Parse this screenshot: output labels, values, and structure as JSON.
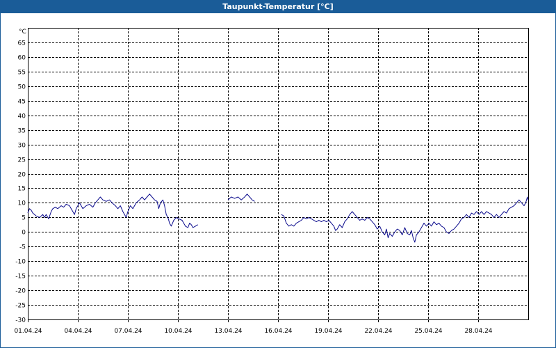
{
  "window": {
    "title": "Taupunkt-Temperatur [°C]"
  },
  "chart_data": {
    "type": "line",
    "title": "Taupunkt-Temperatur [°C]",
    "y_unit_label": "°C",
    "xlabel": "",
    "ylabel": "",
    "ylim": [
      -30,
      70
    ],
    "y_ticks": [
      65,
      60,
      55,
      50,
      45,
      40,
      35,
      30,
      25,
      20,
      15,
      10,
      5,
      0,
      -5,
      -10,
      -15,
      -20,
      -25,
      -30
    ],
    "x_tick_labels": [
      "01.04.24",
      "04.04.24",
      "07.04.24",
      "10.04.24",
      "13.04.24",
      "16.04.24",
      "19.04.24",
      "22.04.24",
      "25.04.24",
      "28.04.24"
    ],
    "x_range_days": [
      0,
      30
    ],
    "grid": true,
    "legend": "none",
    "colors": {
      "line": "#0a0a8c",
      "grid": "#000000",
      "title_bg": "#1a5c98"
    },
    "series": [
      {
        "segments": [
          [
            [
              0.0,
              6.5
            ],
            [
              0.1,
              8
            ],
            [
              0.2,
              7.5
            ],
            [
              0.3,
              6.5
            ],
            [
              0.5,
              5.5
            ],
            [
              0.7,
              5
            ],
            [
              0.9,
              6
            ],
            [
              1.0,
              5
            ],
            [
              1.1,
              6
            ],
            [
              1.25,
              4.5
            ],
            [
              1.4,
              7
            ],
            [
              1.5,
              8
            ],
            [
              1.65,
              8.5
            ],
            [
              1.8,
              8
            ],
            [
              2.0,
              9
            ],
            [
              2.15,
              8.5
            ],
            [
              2.3,
              9.5
            ],
            [
              2.5,
              9
            ],
            [
              2.7,
              7
            ],
            [
              2.8,
              6
            ],
            [
              2.9,
              8
            ],
            [
              3.1,
              10
            ],
            [
              3.3,
              8
            ],
            [
              3.5,
              9
            ],
            [
              3.7,
              9.5
            ],
            [
              3.9,
              8.5
            ],
            [
              4.05,
              10
            ],
            [
              4.2,
              11
            ],
            [
              4.35,
              12
            ],
            [
              4.5,
              11
            ],
            [
              4.7,
              10.5
            ],
            [
              4.9,
              11
            ],
            [
              5.05,
              10
            ],
            [
              5.25,
              9
            ],
            [
              5.4,
              8
            ],
            [
              5.55,
              9
            ],
            [
              5.7,
              7
            ],
            [
              5.8,
              6
            ],
            [
              5.9,
              5
            ],
            [
              6.0,
              7
            ],
            [
              6.15,
              9
            ],
            [
              6.3,
              8
            ],
            [
              6.5,
              10
            ],
            [
              6.7,
              11
            ],
            [
              6.85,
              12
            ],
            [
              7.0,
              11
            ],
            [
              7.15,
              12
            ],
            [
              7.3,
              13
            ],
            [
              7.45,
              12
            ],
            [
              7.6,
              11
            ],
            [
              7.75,
              10.5
            ],
            [
              7.85,
              8
            ],
            [
              7.95,
              10
            ],
            [
              8.1,
              11
            ],
            [
              8.2,
              9
            ],
            [
              8.3,
              6
            ],
            [
              8.4,
              5
            ],
            [
              8.5,
              3
            ],
            [
              8.6,
              2
            ],
            [
              8.75,
              4
            ],
            [
              8.9,
              5
            ],
            [
              9.05,
              4.5
            ],
            [
              9.25,
              4
            ],
            [
              9.35,
              3
            ],
            [
              9.45,
              2
            ],
            [
              9.6,
              1.5
            ],
            [
              9.7,
              3
            ],
            [
              9.8,
              2.5
            ],
            [
              9.9,
              1.5
            ],
            [
              10.05,
              2
            ],
            [
              10.2,
              2.5
            ]
          ],
          [
            [
              12.0,
              11
            ],
            [
              12.2,
              12
            ],
            [
              12.4,
              11.5
            ],
            [
              12.6,
              12
            ],
            [
              12.8,
              11
            ],
            [
              13.0,
              12
            ],
            [
              13.15,
              13
            ],
            [
              13.3,
              12
            ],
            [
              13.45,
              11
            ],
            [
              13.6,
              10.5
            ]
          ],
          [
            [
              15.2,
              6
            ],
            [
              15.35,
              5.5
            ],
            [
              15.5,
              3
            ],
            [
              15.65,
              2
            ],
            [
              15.8,
              2.5
            ],
            [
              15.95,
              2
            ],
            [
              16.1,
              3
            ],
            [
              16.25,
              3.5
            ],
            [
              16.4,
              4
            ],
            [
              16.55,
              5
            ],
            [
              16.7,
              4.5
            ],
            [
              16.85,
              5
            ],
            [
              17.0,
              4.5
            ],
            [
              17.15,
              4
            ],
            [
              17.3,
              3.5
            ],
            [
              17.45,
              4
            ],
            [
              17.6,
              3.5
            ],
            [
              17.75,
              4
            ],
            [
              17.9,
              3.5
            ],
            [
              18.05,
              4
            ],
            [
              18.2,
              3
            ],
            [
              18.35,
              2
            ],
            [
              18.45,
              0.5
            ],
            [
              18.55,
              1
            ],
            [
              18.7,
              2.5
            ],
            [
              18.85,
              1.5
            ],
            [
              19.0,
              3.5
            ],
            [
              19.15,
              4.5
            ],
            [
              19.3,
              6
            ],
            [
              19.45,
              7
            ],
            [
              19.6,
              6
            ],
            [
              19.75,
              5
            ],
            [
              19.9,
              4
            ],
            [
              20.05,
              4.5
            ],
            [
              20.2,
              4
            ],
            [
              20.35,
              5
            ],
            [
              20.5,
              4.5
            ],
            [
              20.65,
              3.5
            ],
            [
              20.8,
              2.5
            ],
            [
              20.95,
              1
            ],
            [
              21.1,
              2
            ],
            [
              21.25,
              0
            ],
            [
              21.4,
              -1
            ],
            [
              21.5,
              1
            ],
            [
              21.6,
              -2
            ],
            [
              21.7,
              -0.5
            ],
            [
              21.85,
              -1.5
            ],
            [
              22.0,
              0
            ],
            [
              22.15,
              1
            ],
            [
              22.3,
              0.5
            ],
            [
              22.45,
              -1
            ],
            [
              22.6,
              1.5
            ],
            [
              22.75,
              -0.5
            ],
            [
              22.9,
              -1
            ],
            [
              23.0,
              0.5
            ],
            [
              23.1,
              -2
            ],
            [
              23.2,
              -3.5
            ],
            [
              23.3,
              -1
            ],
            [
              23.45,
              0
            ],
            [
              23.6,
              1.5
            ],
            [
              23.75,
              3
            ],
            [
              23.9,
              2
            ],
            [
              24.05,
              3
            ],
            [
              24.2,
              2
            ],
            [
              24.35,
              3.5
            ],
            [
              24.5,
              2.5
            ],
            [
              24.65,
              3
            ],
            [
              24.8,
              2
            ],
            [
              24.95,
              1.5
            ],
            [
              25.1,
              0
            ],
            [
              25.25,
              -0.5
            ],
            [
              25.4,
              0.5
            ],
            [
              25.55,
              1
            ],
            [
              25.7,
              2
            ],
            [
              25.85,
              3
            ],
            [
              26.0,
              4.5
            ],
            [
              26.15,
              5
            ],
            [
              26.3,
              6
            ],
            [
              26.45,
              5
            ],
            [
              26.6,
              6.5
            ],
            [
              26.75,
              6
            ],
            [
              26.9,
              7
            ],
            [
              27.05,
              6
            ],
            [
              27.2,
              7
            ],
            [
              27.35,
              6
            ],
            [
              27.5,
              7
            ],
            [
              27.65,
              6.5
            ],
            [
              27.8,
              6
            ],
            [
              27.95,
              5
            ],
            [
              28.1,
              6
            ],
            [
              28.25,
              5
            ],
            [
              28.4,
              6
            ],
            [
              28.55,
              7
            ],
            [
              28.7,
              6.5
            ],
            [
              28.85,
              8
            ],
            [
              29.0,
              8.5
            ],
            [
              29.15,
              9
            ],
            [
              29.3,
              10
            ],
            [
              29.45,
              11
            ],
            [
              29.6,
              10
            ],
            [
              29.75,
              9
            ],
            [
              29.85,
              10
            ],
            [
              29.95,
              12
            ],
            [
              30.0,
              11
            ]
          ]
        ]
      }
    ]
  }
}
